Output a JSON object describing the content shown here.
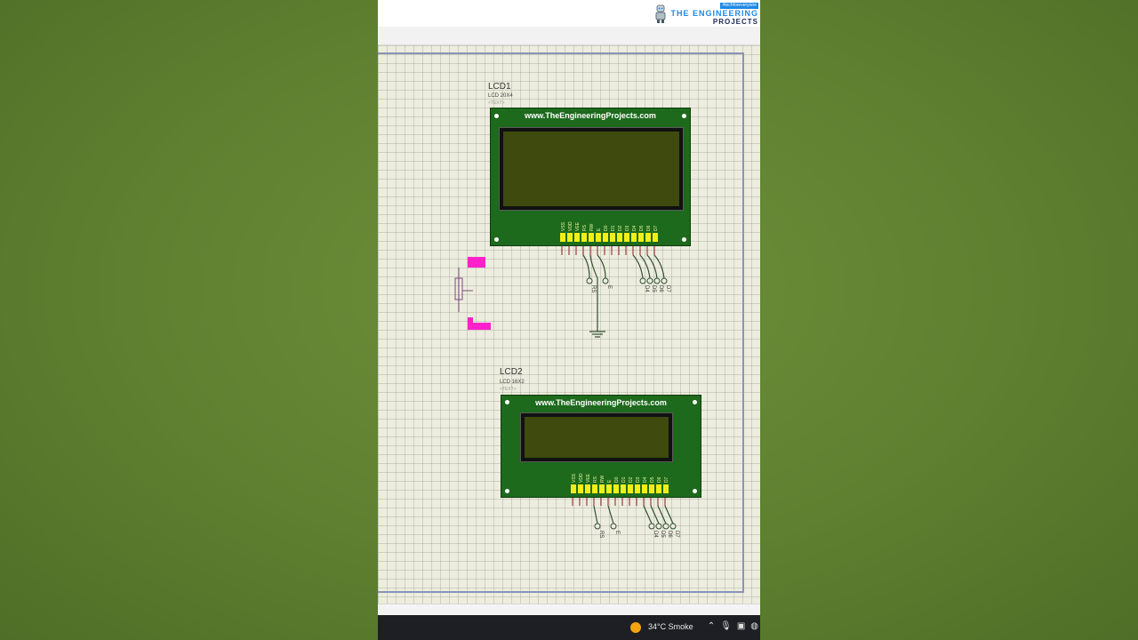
{
  "logo": {
    "tag": "#techforeveryone",
    "line1": "THE ENGINEERING",
    "line2": "PROJECTS"
  },
  "lcd1": {
    "ref": "LCD1",
    "part": "LCD 20X4",
    "text": "<TEXT>",
    "url": "www.TheEngineeringProjects.com",
    "pins": [
      "VSS",
      "VDD",
      "VEE",
      "RS",
      "RW",
      "E",
      "D0",
      "D1",
      "D2",
      "D3",
      "D4",
      "D5",
      "D6",
      "D7"
    ],
    "nets": [
      "RS",
      "E",
      "D4",
      "D5",
      "D6",
      "D7"
    ]
  },
  "lcd2": {
    "ref": "LCD2",
    "part": "LCD 16X2",
    "text": "<TEXT>",
    "url": "www.TheEngineeringProjects.com",
    "pins": [
      "VSS",
      "VDD",
      "VEE",
      "RS",
      "RW",
      "E",
      "D0",
      "D1",
      "D2",
      "D3",
      "D4",
      "D5",
      "D6",
      "D7"
    ],
    "nets": [
      "RS",
      "E",
      "D4",
      "D5",
      "D6",
      "D7"
    ]
  },
  "colors": {
    "board": "#1d6a1d",
    "screen": "#3e4a0e",
    "pin": "#f2ef18",
    "wire": "#2f4f2f",
    "pot": "#ff22cc"
  },
  "taskbar": {
    "weather": "34°C  Smoke"
  }
}
